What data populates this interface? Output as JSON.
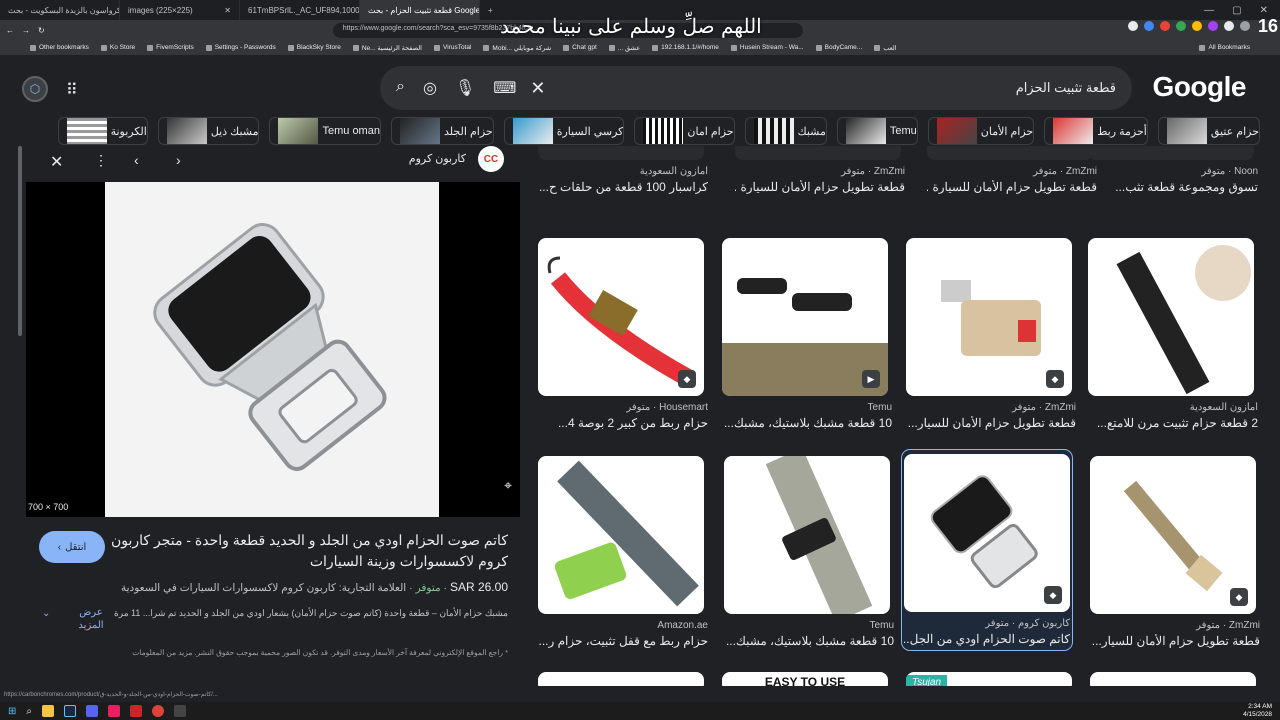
{
  "browser": {
    "tabs": [
      {
        "label": "كرواسون بالزبدة البسكويت - بحث Google"
      },
      {
        "label": "images (225×225)"
      },
      {
        "label": "61TmBPSrlL._AC_UF894,1000_QL80"
      },
      {
        "label": "قطعة تثبيت الحزام - بحث Google",
        "active": true
      }
    ],
    "url": "https://www.google.com/search?sca_esv=9735f8b237bb4fc8...",
    "overlay_text": "اللهم صلِّ وسلم على نبينا محمد",
    "counter": "16",
    "bookmarks": [
      "Other bookmarks",
      "Ko Store",
      "FivemScripts",
      "Settings - Passwords",
      "BlackSky Store",
      "Ne... الصفحة الرئيسية",
      "VirusTotal",
      "Mobi... شركة موبايلي",
      "Chat gpt",
      "... عشق",
      "192.168.1.1/#/home",
      "Husein Stream - Wa...",
      "BodyCame...",
      "العب"
    ],
    "all_bookmarks": "All Bookmarks"
  },
  "search": {
    "query": "قطعة تثبيت الحزام",
    "logo": "Google",
    "icons": [
      "search-icon",
      "lens-icon",
      "mic-icon",
      "keyboard-icon"
    ]
  },
  "chips": [
    "حزام عتيق",
    "أحزمة ربط",
    "حزام الأمان",
    "Temu",
    "مشبك",
    "حزام امان",
    "كرسي السيارة",
    "حزام الجلد",
    "Temu oman",
    "مشبك ذيل",
    "الكربونة"
  ],
  "panel": {
    "site_name": "كاربون كروم",
    "site_logo": "CC",
    "dimensions": "700 × 700",
    "title": "كاتم صوت الحزام اودي من الجلد و الحديد قطعة واحدة - متجر كاربون كروم لاكسسوارات وزينة السيارات",
    "visit_label": "انتقل",
    "price": "SAR 26.00",
    "stock": "متوفر",
    "brand": "العلامة التجارية: كاربون كروم لاكسسوارات السيارات في السعودية",
    "description": "مشبك حزام الأمان – قطعة واحدة (كاتم صوت حزام الأمان) بشعار اودي من الجلد و الحديد تم شرا... 11 مرة",
    "more_label": "عرض المزيد",
    "note": "* راجع الموقع الإلكتروني لمعرفة آخر الأسعار ومدى التوفر. قد تكون الصور محمية بموجب حقوق النشر. مزيد من المعلومات"
  },
  "top_row": [
    {
      "source": "امازون السعودية",
      "title": "كراسبار 100 قطعة من حلقات ح..."
    },
    {
      "source": "ZmZmi · متوفر",
      "title": "قطعة تطويل حزام الأمان للسيارة ..."
    },
    {
      "source": "ZmZmi · متوفر",
      "title": "قطعة تطويل حزام الأمان للسيارة ..."
    },
    {
      "source": "Noon · متوفر",
      "title": "تسوق ومجموعة قطعة تثب..."
    }
  ],
  "results": [
    {
      "source": "Housemart · متوفر",
      "title": "حزام ربط من كبير 2 بوصة 4...",
      "kind": "strap-red"
    },
    {
      "source": "Temu",
      "title": "10 قطعة مشبك بلاستيك، مشبك...",
      "kind": "clips"
    },
    {
      "source": "ZmZmi · متوفر",
      "title": "قطعة تطويل حزام الأمان للسيار...",
      "kind": "beige"
    },
    {
      "source": "امازون السعودية",
      "title": "2 قطعة حزام تثبيت مرن للامتع...",
      "kind": "black-strap"
    },
    {
      "source": "Amazon.ae",
      "title": "حزام ربط مع قفل تثبيت، حزام ر...",
      "kind": "strap-green"
    },
    {
      "source": "Temu",
      "title": "10 قطعة مشبك بلاستيك، مشبك...",
      "kind": "grey-strap"
    },
    {
      "source": "كاربون كروم · متوفر",
      "title": "كاتم صوت الحزام اودي من الجل...",
      "kind": "buckle",
      "selected": true
    },
    {
      "source": "ZmZmi · متوفر",
      "title": "قطعة تطويل حزام الأمان للسيار...",
      "kind": "tan"
    }
  ],
  "bottom_row": [
    {
      "label": ""
    },
    {
      "label": "EASY TO USE"
    },
    {
      "label": "Tsujan"
    },
    {
      "label": ""
    }
  ],
  "status_url": "https://carbonchromes.com/product/كاتم-صوت-الحزام-اودي-من-الجلد-و-الحديد-ق/...",
  "clock": {
    "time": "2:34 AM",
    "date": "4/15/2028"
  }
}
